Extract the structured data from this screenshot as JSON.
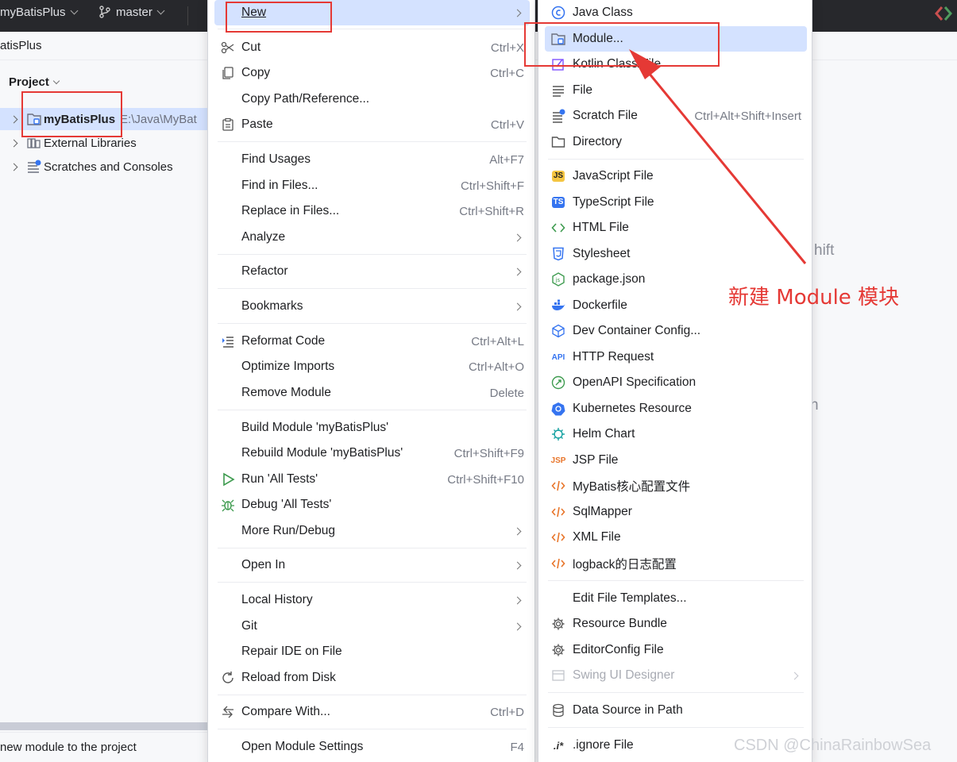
{
  "titlebar": {
    "project": "myBatisPlus",
    "branch": "master"
  },
  "breadcrumb": "atisPlus",
  "project_panel": {
    "header": "Project",
    "tree": [
      {
        "label": "myBatisPlus",
        "path": "E:\\Java\\MyBat"
      },
      {
        "label": "External Libraries"
      },
      {
        "label": "Scratches and Consoles"
      }
    ]
  },
  "statusbar": "new module to the project",
  "background_hints": [
    "hift",
    "n"
  ],
  "context_menu": {
    "new": "New",
    "cut": {
      "label": "Cut",
      "shortcut": "Ctrl+X"
    },
    "copy": {
      "label": "Copy",
      "shortcut": "Ctrl+C"
    },
    "copy_path": "Copy Path/Reference...",
    "paste": {
      "label": "Paste",
      "shortcut": "Ctrl+V"
    },
    "find_usages": {
      "label": "Find Usages",
      "shortcut": "Alt+F7"
    },
    "find_in_files": {
      "label": "Find in Files...",
      "shortcut": "Ctrl+Shift+F"
    },
    "replace_in_files": {
      "label": "Replace in Files...",
      "shortcut": "Ctrl+Shift+R"
    },
    "analyze": "Analyze",
    "refactor": "Refactor",
    "bookmarks": "Bookmarks",
    "reformat_code": {
      "label": "Reformat Code",
      "shortcut": "Ctrl+Alt+L"
    },
    "optimize_imports": {
      "label": "Optimize Imports",
      "shortcut": "Ctrl+Alt+O"
    },
    "remove_module": {
      "label": "Remove Module",
      "shortcut": "Delete"
    },
    "build_module": "Build Module 'myBatisPlus'",
    "rebuild_module": {
      "label": "Rebuild Module 'myBatisPlus'",
      "shortcut": "Ctrl+Shift+F9"
    },
    "run_tests": {
      "label": "Run 'All Tests'",
      "shortcut": "Ctrl+Shift+F10"
    },
    "debug_tests": "Debug 'All Tests'",
    "more_run_debug": "More Run/Debug",
    "open_in": "Open In",
    "local_history": "Local History",
    "git": "Git",
    "repair_ide": "Repair IDE on File",
    "reload_from_disk": "Reload from Disk",
    "compare_with": {
      "label": "Compare With...",
      "shortcut": "Ctrl+D"
    },
    "open_module_settings": {
      "label": "Open Module Settings",
      "shortcut": "F4"
    }
  },
  "new_submenu": {
    "java_class": "Java Class",
    "module": "Module...",
    "kotlin_class": "Kotlin Class/File",
    "file": "File",
    "scratch_file": {
      "label": "Scratch File",
      "shortcut": "Ctrl+Alt+Shift+Insert"
    },
    "directory": "Directory",
    "javascript_file": "JavaScript File",
    "typescript_file": "TypeScript File",
    "html_file": "HTML File",
    "stylesheet": "Stylesheet",
    "package_json": "package.json",
    "dockerfile": "Dockerfile",
    "dev_container": "Dev Container Config...",
    "http_request": "HTTP Request",
    "openapi": "OpenAPI Specification",
    "kubernetes": "Kubernetes Resource",
    "helm_chart": "Helm Chart",
    "jsp_file": "JSP File",
    "mybatis_config": "MyBatis核心配置文件",
    "sqlmapper": "SqlMapper",
    "xml_file": "XML File",
    "logback": "logback的日志配置",
    "edit_templates": "Edit File Templates...",
    "resource_bundle": "Resource Bundle",
    "editorconfig": "EditorConfig File",
    "swing_ui": "Swing UI Designer",
    "data_source": "Data Source in Path",
    "ignore_file": ".ignore File"
  },
  "icon_glyphs": {
    "js": "JS",
    "ts": "TS",
    "api": "API",
    "jsp": "JSP",
    "ignore": ".i*"
  },
  "annotation": "新建 Module 模块",
  "watermark": "CSDN @ChinaRainbowSea",
  "colors": {
    "accent": "#3574f0",
    "highlight": "#d4e2ff",
    "annotation_red": "#e53935",
    "titlebar": "#27282c"
  }
}
